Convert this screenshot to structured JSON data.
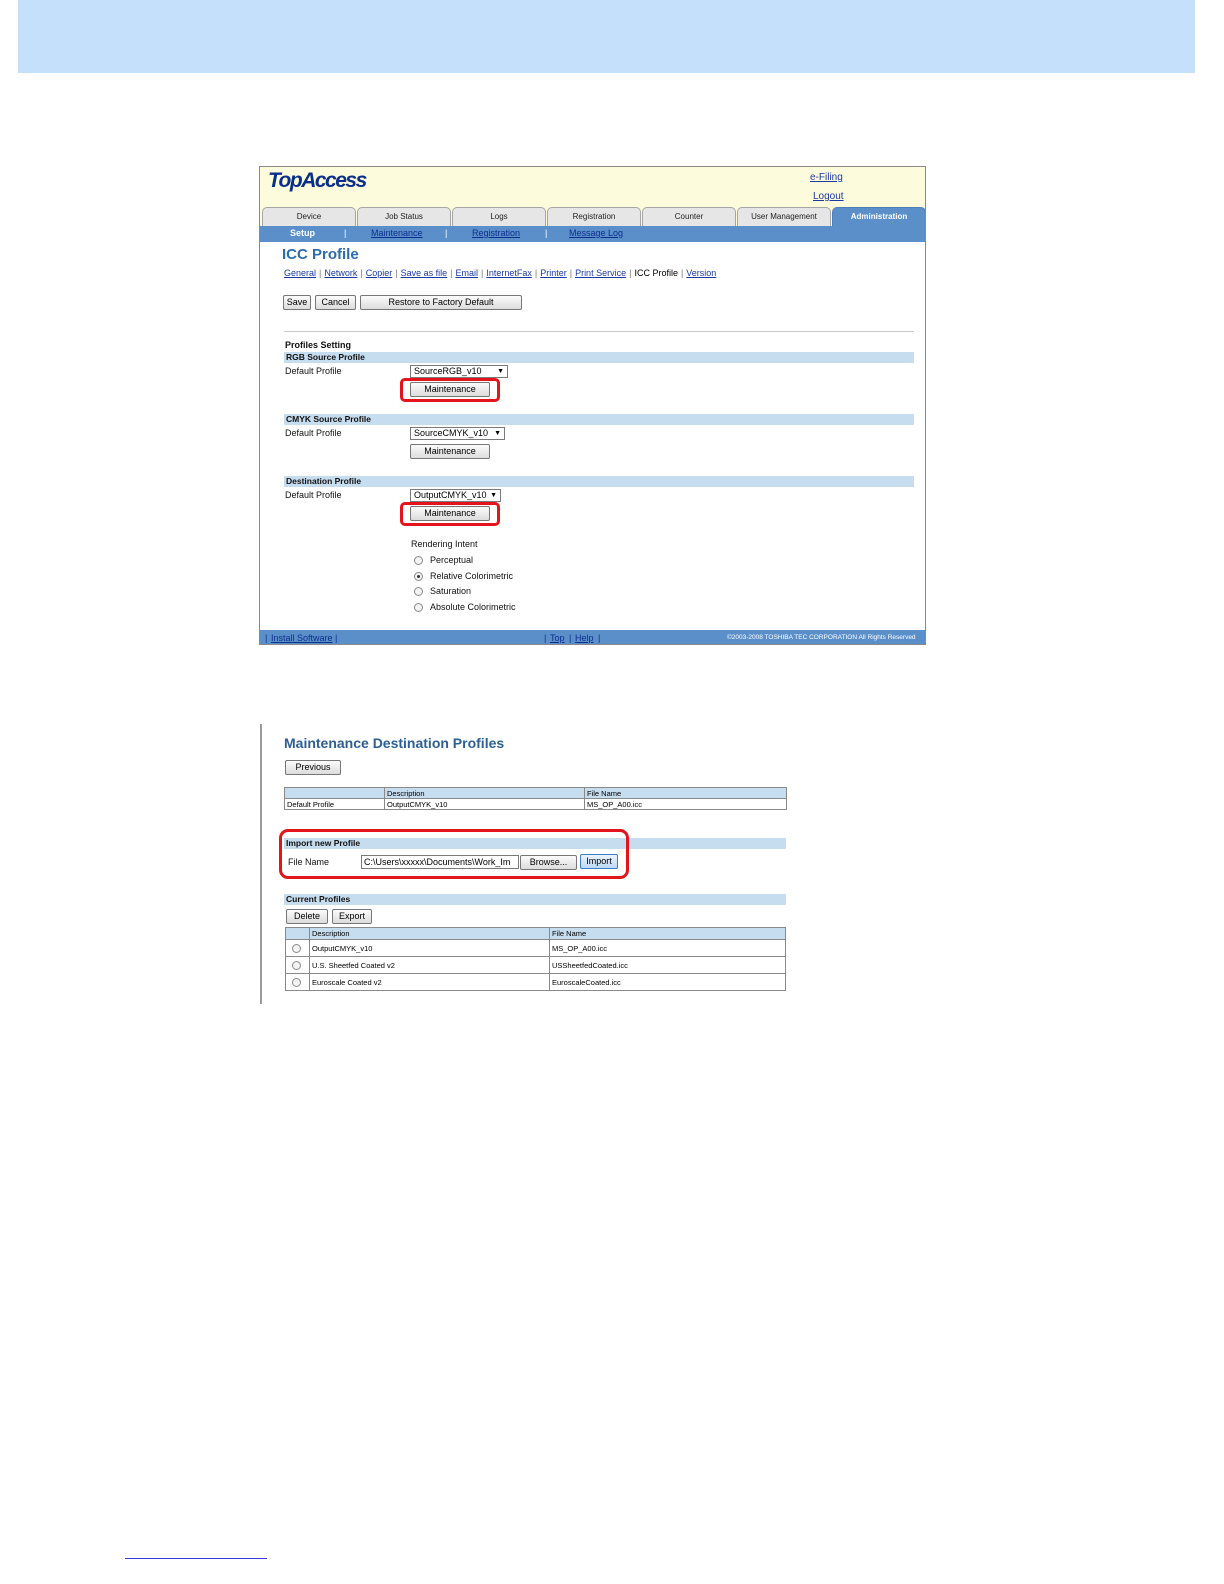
{
  "topaccess": {
    "logo": "TopAccess",
    "efiling": "e-Filing",
    "logout": "Logout",
    "tabs": [
      "Device",
      "Job Status",
      "Logs",
      "Registration",
      "Counter",
      "User Management",
      "Administration"
    ],
    "active_tab": "Administration",
    "subnav": {
      "setup": "Setup",
      "maintenance": "Maintenance",
      "registration": "Registration",
      "message_log": "Message Log",
      "sep": "|"
    },
    "page_title": "ICC Profile",
    "links": [
      "General",
      "Network",
      "Copier",
      "Save as file",
      "Email",
      "InternetFax",
      "Printer",
      "Print Service",
      "ICC Profile",
      "Version"
    ],
    "current_link": "ICC Profile",
    "buttons": {
      "save": "Save",
      "cancel": "Cancel",
      "restore": "Restore to Factory Default"
    },
    "profiles_setting": "Profiles Setting",
    "rgb": {
      "header": "RGB Source Profile",
      "label": "Default Profile",
      "value": "SourceRGB_v10",
      "maintenance": "Maintenance"
    },
    "cmyk": {
      "header": "CMYK Source Profile",
      "label": "Default Profile",
      "value": "SourceCMYK_v10",
      "maintenance": "Maintenance"
    },
    "destination": {
      "header": "Destination Profile",
      "label": "Default Profile",
      "value": "OutputCMYK_v10",
      "maintenance": "Maintenance"
    },
    "rendering_intent": {
      "label": "Rendering Intent",
      "options": [
        "Perceptual",
        "Relative Colorimetric",
        "Saturation",
        "Absolute Colorimetric"
      ],
      "selected": "Relative Colorimetric"
    },
    "footer": {
      "install_software": "Install Software",
      "top": "Top",
      "help": "Help",
      "copyright": "©2003-2008 TOSHIBA TEC CORPORATION All Rights Reserved"
    }
  },
  "maintenance_dest": {
    "title": "Maintenance Destination Profiles",
    "previous": "Previous",
    "default_table": {
      "headers": [
        "",
        "Description",
        "File Name"
      ],
      "row": [
        "Default Profile",
        "OutputCMYK_v10",
        "MS_OP_A00.icc"
      ]
    },
    "import": {
      "header": "Import new Profile",
      "label": "File Name",
      "value": "C:\\Users\\xxxxx\\Documents\\Work_Im",
      "browse": "Browse...",
      "import": "Import"
    },
    "current": {
      "header": "Current Profiles",
      "delete": "Delete",
      "export": "Export",
      "headers": [
        "",
        "Description",
        "File Name"
      ],
      "rows": [
        [
          "OutputCMYK_v10",
          "MS_OP_A00.icc"
        ],
        [
          "U.S. Sheetfed Coated v2",
          "USSheetfedCoated.icc"
        ],
        [
          "Euroscale Coated v2",
          "EuroscaleCoated.icc"
        ]
      ]
    }
  },
  "colors": {
    "accent_blue": "#5b8fca",
    "band_blue": "#c6dcef",
    "highlight_red": "#e3141b",
    "top_band": "#c5e0fb"
  }
}
